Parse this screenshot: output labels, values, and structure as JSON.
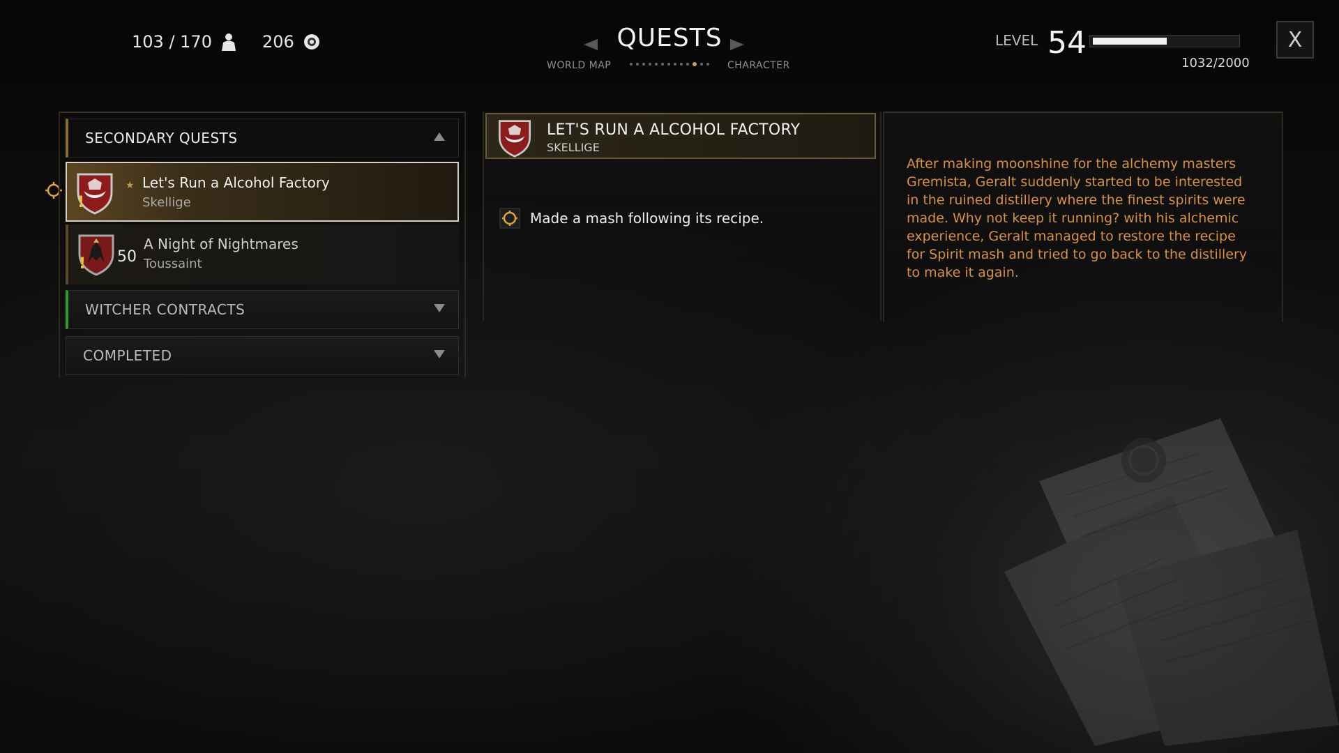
{
  "top_bar": {
    "weight": "103 / 170",
    "crowns": "206",
    "title": "QUESTS",
    "nav_left": "WORLD MAP",
    "nav_right": "CHARACTER",
    "nav_dots_total": 13,
    "nav_dots_active": 11,
    "level_label": "LEVEL",
    "level_value": "54",
    "xp_text": "1032/2000",
    "xp_progress": 0.516,
    "close_label": "X"
  },
  "quest_list": {
    "categories": {
      "secondary": "SECONDARY QUESTS",
      "contracts": "WITCHER CONTRACTS",
      "completed": "COMPLETED"
    },
    "quests": [
      {
        "name": "Let's Run a Alcohol Factory",
        "region": "Skellige",
        "level": "",
        "selected": true,
        "tracked": true
      },
      {
        "name": "A Night of Nightmares",
        "region": "Toussaint",
        "level": "50",
        "selected": false,
        "tracked": false
      }
    ]
  },
  "detail": {
    "title": "LET'S RUN A ALCOHOL FACTORY",
    "region": "SKELLIGE",
    "objective": "Made a mash following its recipe."
  },
  "description": "After making moonshine for the alchemy masters Gremista, Geralt suddenly started to be interested in the ruined distillery where the finest spirits were made. Why not keep it running? with his alchemic experience, Geralt managed to restore the recipe for Spirit mash and tried to go back to the distillery to make it again.",
  "colors": {
    "accent_gold": "#d2a04a",
    "description_text": "#d8913e",
    "contracts_marker": "#2f9a2f",
    "exclamation": "#e8c23a"
  },
  "icons": {
    "weight": "person-weight-icon",
    "crowns": "crowns-coin-icon",
    "quest_shield": "skellige-shield-icon",
    "quest_shield_2": "toussaint-shield-icon",
    "objective": "objective-marker-icon"
  }
}
